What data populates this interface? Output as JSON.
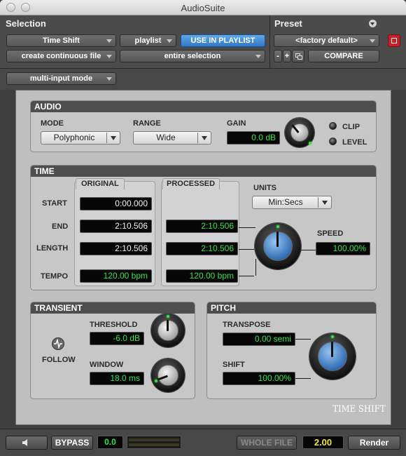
{
  "window": {
    "title": "AudioSuite"
  },
  "selection": {
    "header": "Selection",
    "plugin": "Time Shift",
    "playlist": "playlist",
    "use_in_playlist": "USE IN PLAYLIST",
    "file_mode": "create continuous file",
    "range": "entire selection",
    "input_mode": "multi-input mode"
  },
  "preset": {
    "header": "Preset",
    "name": "<factory default>",
    "minus": "-",
    "plus": "+",
    "compare": "COMPARE"
  },
  "audio": {
    "header": "AUDIO",
    "mode_label": "MODE",
    "mode_value": "Polyphonic",
    "range_label": "RANGE",
    "range_value": "Wide",
    "gain_label": "GAIN",
    "gain_value": "0.0 dB",
    "clip_label": "CLIP",
    "level_label": "LEVEL"
  },
  "time": {
    "header": "TIME",
    "original_tab": "ORIGINAL",
    "processed_tab": "PROCESSED",
    "units_label": "UNITS",
    "units_value": "Min:Secs",
    "start_label": "START",
    "end_label": "END",
    "length_label": "LENGTH",
    "tempo_label": "TEMPO",
    "start_value": "0:00.000",
    "end_orig": "2:10.506",
    "length_orig": "2:10.506",
    "tempo_orig": "120.00 bpm",
    "end_proc": "2:10.506",
    "length_proc": "2:10.506",
    "tempo_proc": "120.00 bpm",
    "speed_label": "SPEED",
    "speed_value": "100.00%"
  },
  "transient": {
    "header": "TRANSIENT",
    "follow_label": "FOLLOW",
    "threshold_label": "THRESHOLD",
    "threshold_value": "-6.0 dB",
    "window_label": "WINDOW",
    "window_value": "18.0 ms"
  },
  "pitch": {
    "header": "PITCH",
    "transpose_label": "TRANSPOSE",
    "transpose_value": "0.00 semi",
    "shift_label": "SHIFT",
    "shift_value": "100.00%"
  },
  "logo": "TIME SHIFT",
  "footer": {
    "bypass": "BYPASS",
    "level": "0.0",
    "whole_file": "WHOLE FILE",
    "handle": "2.00",
    "render": "Render"
  },
  "colors": {
    "accent_blue": "#2f6fb5",
    "readout_green": "#2ee64a",
    "close_red": "#c8202a"
  }
}
